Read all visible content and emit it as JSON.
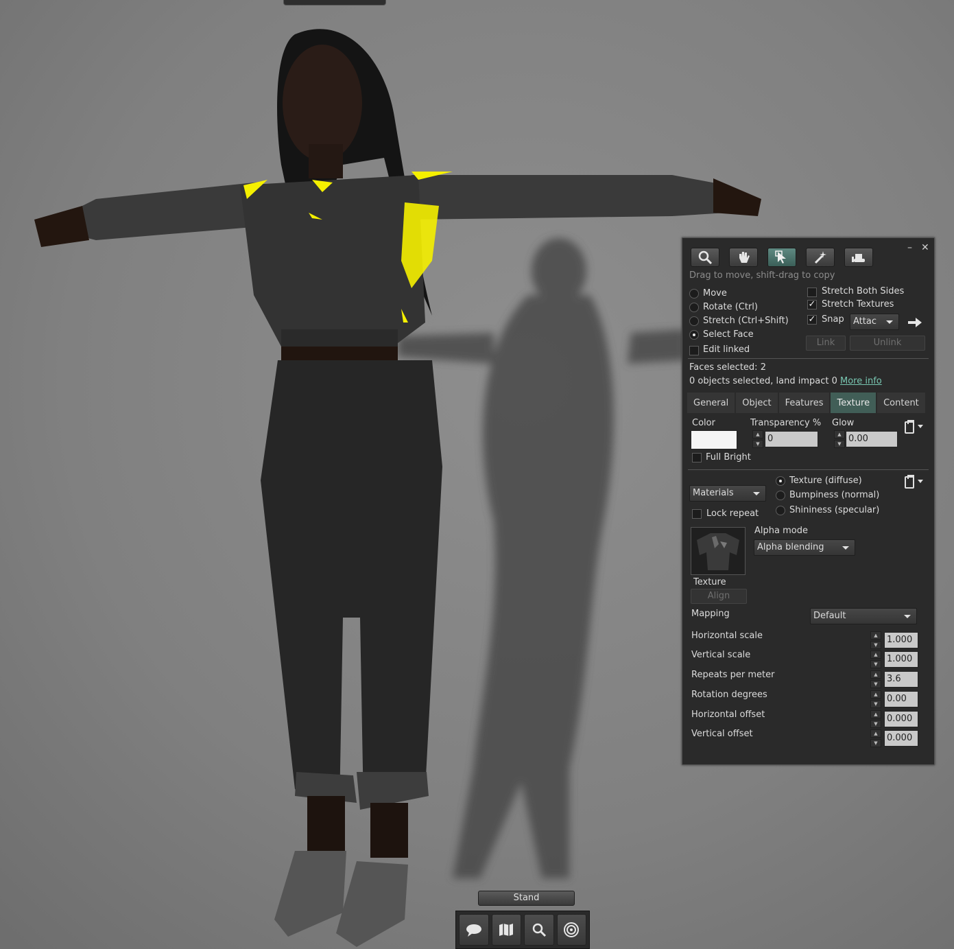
{
  "build_floater": {
    "hint": "Drag to move, shift-drag to copy",
    "window": {
      "minimize": "–",
      "close": "✕"
    },
    "tools": [
      {
        "name": "focus",
        "icon": "magnifier-icon"
      },
      {
        "name": "move",
        "icon": "grab-hand-icon"
      },
      {
        "name": "edit",
        "icon": "pointer-arrow-icon",
        "active": true
      },
      {
        "name": "create",
        "icon": "magic-wand-icon"
      },
      {
        "name": "land",
        "icon": "bulldozer-icon"
      }
    ],
    "modes": {
      "move": "Move",
      "rotate": "Rotate (Ctrl)",
      "stretch": "Stretch (Ctrl+Shift)",
      "select_face": "Select Face",
      "selected": "select_face"
    },
    "edit_linked": "Edit linked",
    "stretch_both_sides": "Stretch Both Sides",
    "stretch_textures": "Stretch Textures",
    "snap": "Snap",
    "snap_target": "Attac",
    "link": "Link",
    "unlink": "Unlink",
    "faces_selected": "Faces selected: 2",
    "objects_selected": "0 objects selected, land impact 0",
    "more_info": "More info",
    "tabs": [
      "General",
      "Object",
      "Features",
      "Texture",
      "Content"
    ],
    "active_tab": "Texture",
    "texture_tab": {
      "color_label": "Color",
      "color_value": "#f5f5f5",
      "transparency_label": "Transparency %",
      "transparency_value": "0",
      "glow_label": "Glow",
      "glow_value": "0.00",
      "full_bright": "Full Bright",
      "materials_combo": "Materials",
      "lock_repeat": "Lock repeat",
      "channels": {
        "diffuse": "Texture (diffuse)",
        "normal": "Bumpiness (normal)",
        "specular": "Shininess (specular)"
      },
      "alpha_mode_label": "Alpha mode",
      "alpha_mode_value": "Alpha blending",
      "texture_label": "Texture",
      "align_button": "Align",
      "mapping_label": "Mapping",
      "mapping_value": "Default",
      "params": [
        {
          "label": "Horizontal scale",
          "value": "1.000"
        },
        {
          "label": "Vertical scale",
          "value": "1.000"
        },
        {
          "label": "Repeats per meter",
          "value": "3.6"
        },
        {
          "label": "Rotation degrees",
          "value": "0.00"
        },
        {
          "label": "Horizontal offset",
          "value": "0.000"
        },
        {
          "label": "Vertical offset",
          "value": "0.000"
        }
      ]
    }
  },
  "bottom": {
    "stand_button": "Stand",
    "toolbar": [
      {
        "name": "chat",
        "icon": "speech-bubble-icon"
      },
      {
        "name": "map",
        "icon": "map-icon"
      },
      {
        "name": "search",
        "icon": "search-icon"
      },
      {
        "name": "voice",
        "icon": "radar-icon"
      }
    ]
  }
}
